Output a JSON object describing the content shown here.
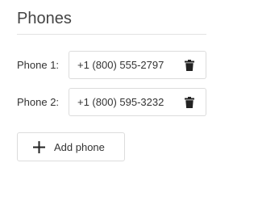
{
  "section": {
    "title": "Phones"
  },
  "phones": [
    {
      "label": "Phone 1:",
      "value": "+1 (800) 555-2797",
      "delete_icon": "trash-icon"
    },
    {
      "label": "Phone 2:",
      "value": "+1 (800) 595-3232",
      "delete_icon": "trash-icon"
    }
  ],
  "add_button": {
    "label": "Add phone",
    "icon": "plus-icon"
  },
  "colors": {
    "text": "#333333",
    "title": "#444444",
    "border": "#dcdcdc",
    "divider": "#e2e2e2"
  }
}
